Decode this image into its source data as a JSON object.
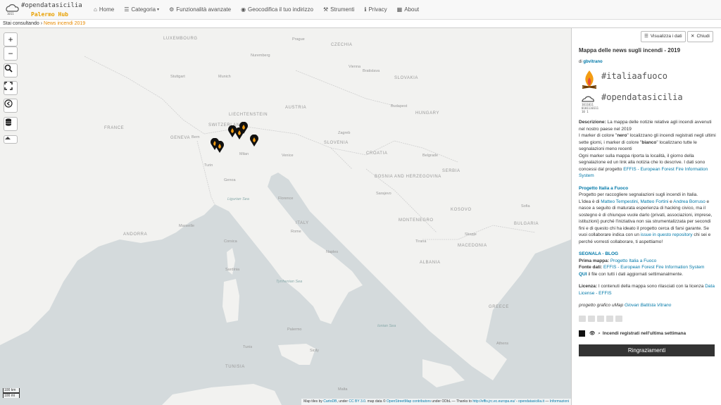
{
  "brand": {
    "line1": "#opendatasicilia",
    "line2": "Palermo Hub"
  },
  "nav": [
    {
      "icon": "⌂",
      "label": "Home"
    },
    {
      "icon": "☰",
      "label": "Categoria",
      "caret": "▾"
    },
    {
      "icon": "⚙",
      "label": "Funzionalità avanzate"
    },
    {
      "icon": "◉",
      "label": "Geocodifica il tuo indirizzo"
    },
    {
      "icon": "⚒",
      "label": "Strumenti"
    },
    {
      "icon": "ℹ",
      "label": "Privacy"
    },
    {
      "icon": "▦",
      "label": "About"
    }
  ],
  "breadcrumb": {
    "prefix": "Stai consultando",
    "sep": "›",
    "current": "News incendi 2019"
  },
  "map": {
    "labels": [
      "LUXEMBOURG",
      "Prague",
      "Nuremberg",
      "CZECHIA",
      "Stuttgart",
      "Munich",
      "Vienna",
      "SLOVAKIA",
      "Bratislava",
      "FRANCE",
      "LIECHTENSTEIN",
      "AUSTRIA",
      "Budapest",
      "HUNGARY",
      "Bern",
      "SWITZERLAND",
      "GENEVA",
      "SLOVENIA",
      "CROATIA",
      "Zagreb",
      "Milan",
      "Venice",
      "Turin",
      "Genoa",
      "Belgrade",
      "SERBIA",
      "BOSNIA AND HERZEGOVINA",
      "Sarajevo",
      "Marseille",
      "Ligurian Sea",
      "Corsica",
      "ANDORRA",
      "Florence",
      "Rome",
      "ITALY",
      "MONTENEGRO",
      "KOSOVO",
      "Skopje",
      "MACEDONIA",
      "BULGARIA",
      "Sofia",
      "Tirana",
      "ALBANIA",
      "Sardinia",
      "Tyrrhenian Sea",
      "Naples",
      "Palermo",
      "Sicily",
      "Ionian Sea",
      "GREECE",
      "Athens",
      "TUNISIA",
      "Tunis",
      "Malta"
    ],
    "scale_km": "100 km",
    "scale_mi": "100 mi",
    "attribution": {
      "prefix": "Map tiles by",
      "carto": "CartoDB",
      "under": ", under",
      "cc": "CC BY 3.0",
      "mapdata": ". map data ©",
      "osm": "OpenStreetMap contributors",
      "odbl": "under ODbL — Thanks to",
      "effis": "http://effis.jrc.ec.europa.eu/",
      "dash": "-",
      "site": "opendatasicilia.it",
      "sep": "—",
      "info": "Informazioni"
    }
  },
  "controls": {
    "zoom_in": "+",
    "zoom_out": "−"
  },
  "panel": {
    "btn_data": "Visualizza i dati",
    "btn_close": "Chiudi",
    "title": "Mappa delle news sugli incendi - 2019",
    "by_prefix": "di",
    "by_user": "gbvitrano",
    "tag1": "#italiaafuoco",
    "tag2": "#opendatasicilia",
    "binary": "1011011\n0101110111\n10 1",
    "desc_label": "Descrizione:",
    "desc1": "La mappa delle notizie relative agli incendi avvenuti nel nostro paese nel 2019",
    "desc2a": "I marker di colore \"",
    "desc2b": "nero",
    "desc2c": "\" localizzano gli incendi registrati negli ultimi sette giorni, i marker di colore \"",
    "desc2d": "bianco",
    "desc2e": "\" localizzano tutte le segnalazioni meno recenti",
    "desc3": "Ogni marker sulla mappa riporta la località, il giorno della segnalazione ed un link alla notizia che lo descrive. I dati sono concessi dal progetto",
    "desc3_link": "EFFIS - European Forest Fire Information System",
    "proj_title": "Progetto Italia a Fuoco",
    "proj_text1": "Progetto per raccogliere segnalazioni sugli incendi in Italia.",
    "proj_text2": "L'idea è di",
    "proj_p1": "Matteo Tempestini",
    "proj_p2": "Matteo Fortini",
    "proj_and": "e",
    "proj_p3": "Andrea Borruso",
    "proj_text3": "e nasce a seguito di maturata esperienza di hacking civico, ma il sostegno è di chiunque vuole darlo (privati, associazioni, imprese, istituzioni) purché l'iniziativa non sia strumentalizzata per secondi fini e di questo chi ha ideato il progetto cerca di farsi garante. Se vuoi collaborare indica con un",
    "proj_issue": "issue in questo repository",
    "proj_text4": "chi sei e perché vorresti collaborare, ti aspettiamo!",
    "segnala": "SEGNALA - BLOG",
    "prima_label": "Prima mappa:",
    "prima_link": "Progetto Italia a Fuoco",
    "fonte_label": "Fonte dati:",
    "fonte_link": "EFFIS - European Forest Fire Information System",
    "qui": "QUI",
    "qui_text": "il file con tutti i dati aggiornati settimanalmente.",
    "lic_label": "Licenza:",
    "lic_text": "I contenuti della mappa sono rilasciati con la licenza",
    "lic_link": "Data License - EFFIS",
    "credit_text": "progetto grafico uMap",
    "credit_link": "Giovan Battista Vitrano",
    "layer_label": "Incendi registrati nell'ultima settimana",
    "thanks": "Ringraziamenti"
  }
}
